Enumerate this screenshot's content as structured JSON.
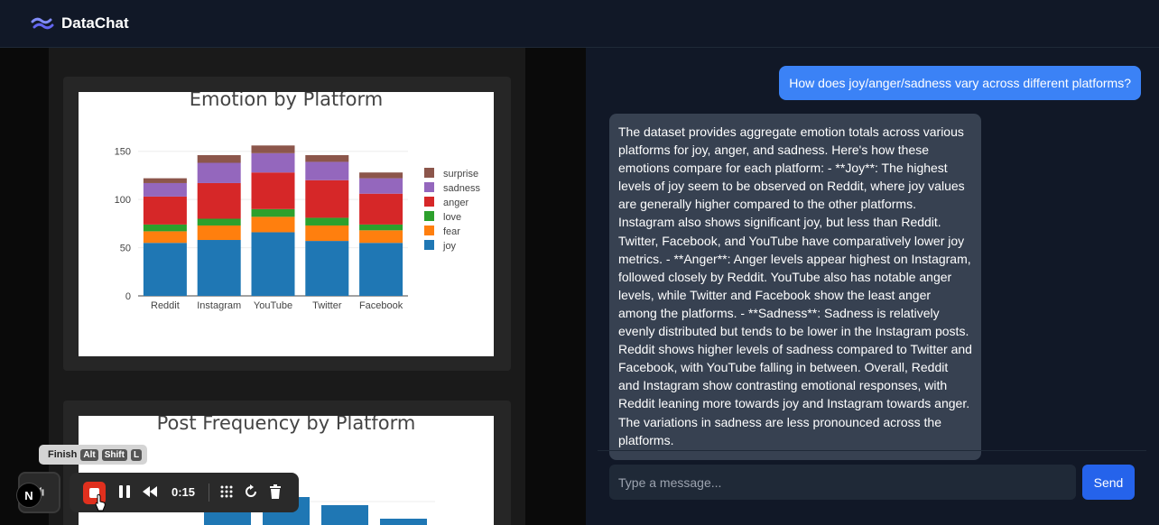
{
  "app": {
    "title": "DataChat"
  },
  "charts": {
    "emotion": {
      "title": "Emotion by Platform"
    },
    "frequency": {
      "title": "Post Frequency by Platform"
    }
  },
  "chart_data": [
    {
      "type": "bar",
      "title": "Emotion by Platform",
      "stacked": true,
      "categories": [
        "Reddit",
        "Instagram",
        "YouTube",
        "Twitter",
        "Facebook"
      ],
      "series": [
        {
          "name": "joy",
          "color": "#1f77b4",
          "values": [
            55,
            58,
            66,
            57,
            55
          ]
        },
        {
          "name": "fear",
          "color": "#ff7f0e",
          "values": [
            12,
            15,
            16,
            16,
            13
          ]
        },
        {
          "name": "love",
          "color": "#2ca02c",
          "values": [
            7,
            7,
            8,
            8,
            6
          ]
        },
        {
          "name": "anger",
          "color": "#d62728",
          "values": [
            29,
            37,
            38,
            39,
            32
          ]
        },
        {
          "name": "sadness",
          "color": "#9467bd",
          "values": [
            14,
            21,
            20,
            19,
            16
          ]
        },
        {
          "name": "surprise",
          "color": "#8c564b",
          "values": [
            5,
            8,
            8,
            7,
            6
          ]
        }
      ],
      "yticks": [
        0,
        50,
        100,
        150
      ],
      "ylim": [
        0,
        160
      ],
      "legend_position": "right",
      "legend_order": [
        "surprise",
        "sadness",
        "anger",
        "love",
        "fear",
        "joy"
      ],
      "grid": true
    },
    {
      "type": "bar",
      "title": "Post Frequency by Platform",
      "note": "partially visible, cut off at bottom",
      "bar_color": "#1f77b4"
    }
  ],
  "chat": {
    "user_message": "How does joy/anger/sadness vary across different platforms?",
    "bot_message": "The dataset provides aggregate emotion totals across various platforms for joy, anger, and sadness. Here's how these emotions compare for each platform: - **Joy**: The highest levels of joy seem to be observed on Reddit, where joy values are generally higher compared to the other platforms. Instagram also shows significant joy, but less than Reddit. Twitter, Facebook, and YouTube have comparatively lower joy metrics. - **Anger**: Anger levels appear highest on Instagram, followed closely by Reddit. YouTube also has notable anger levels, while Twitter and Facebook show the least anger among the platforms. - **Sadness**: Sadness is relatively evenly distributed but tends to be lower in the Instagram posts. Reddit shows higher levels of sadness compared to Twitter and Facebook, with YouTube falling in between. Overall, Reddit and Instagram show contrasting emotional responses, with Reddit leaning more towards joy and Instagram towards anger. The variations in sadness are less pronounced across the platforms.",
    "input_placeholder": "Type a message...",
    "send_label": "Send"
  },
  "recorder": {
    "finish_label": "Finish",
    "shortcut_keys": [
      "Alt",
      "Shift",
      "L"
    ],
    "time": "0:15",
    "badge": "N"
  },
  "colors": {
    "accent": "#3b82f6",
    "send": "#2563eb",
    "stop": "#e0301e"
  }
}
